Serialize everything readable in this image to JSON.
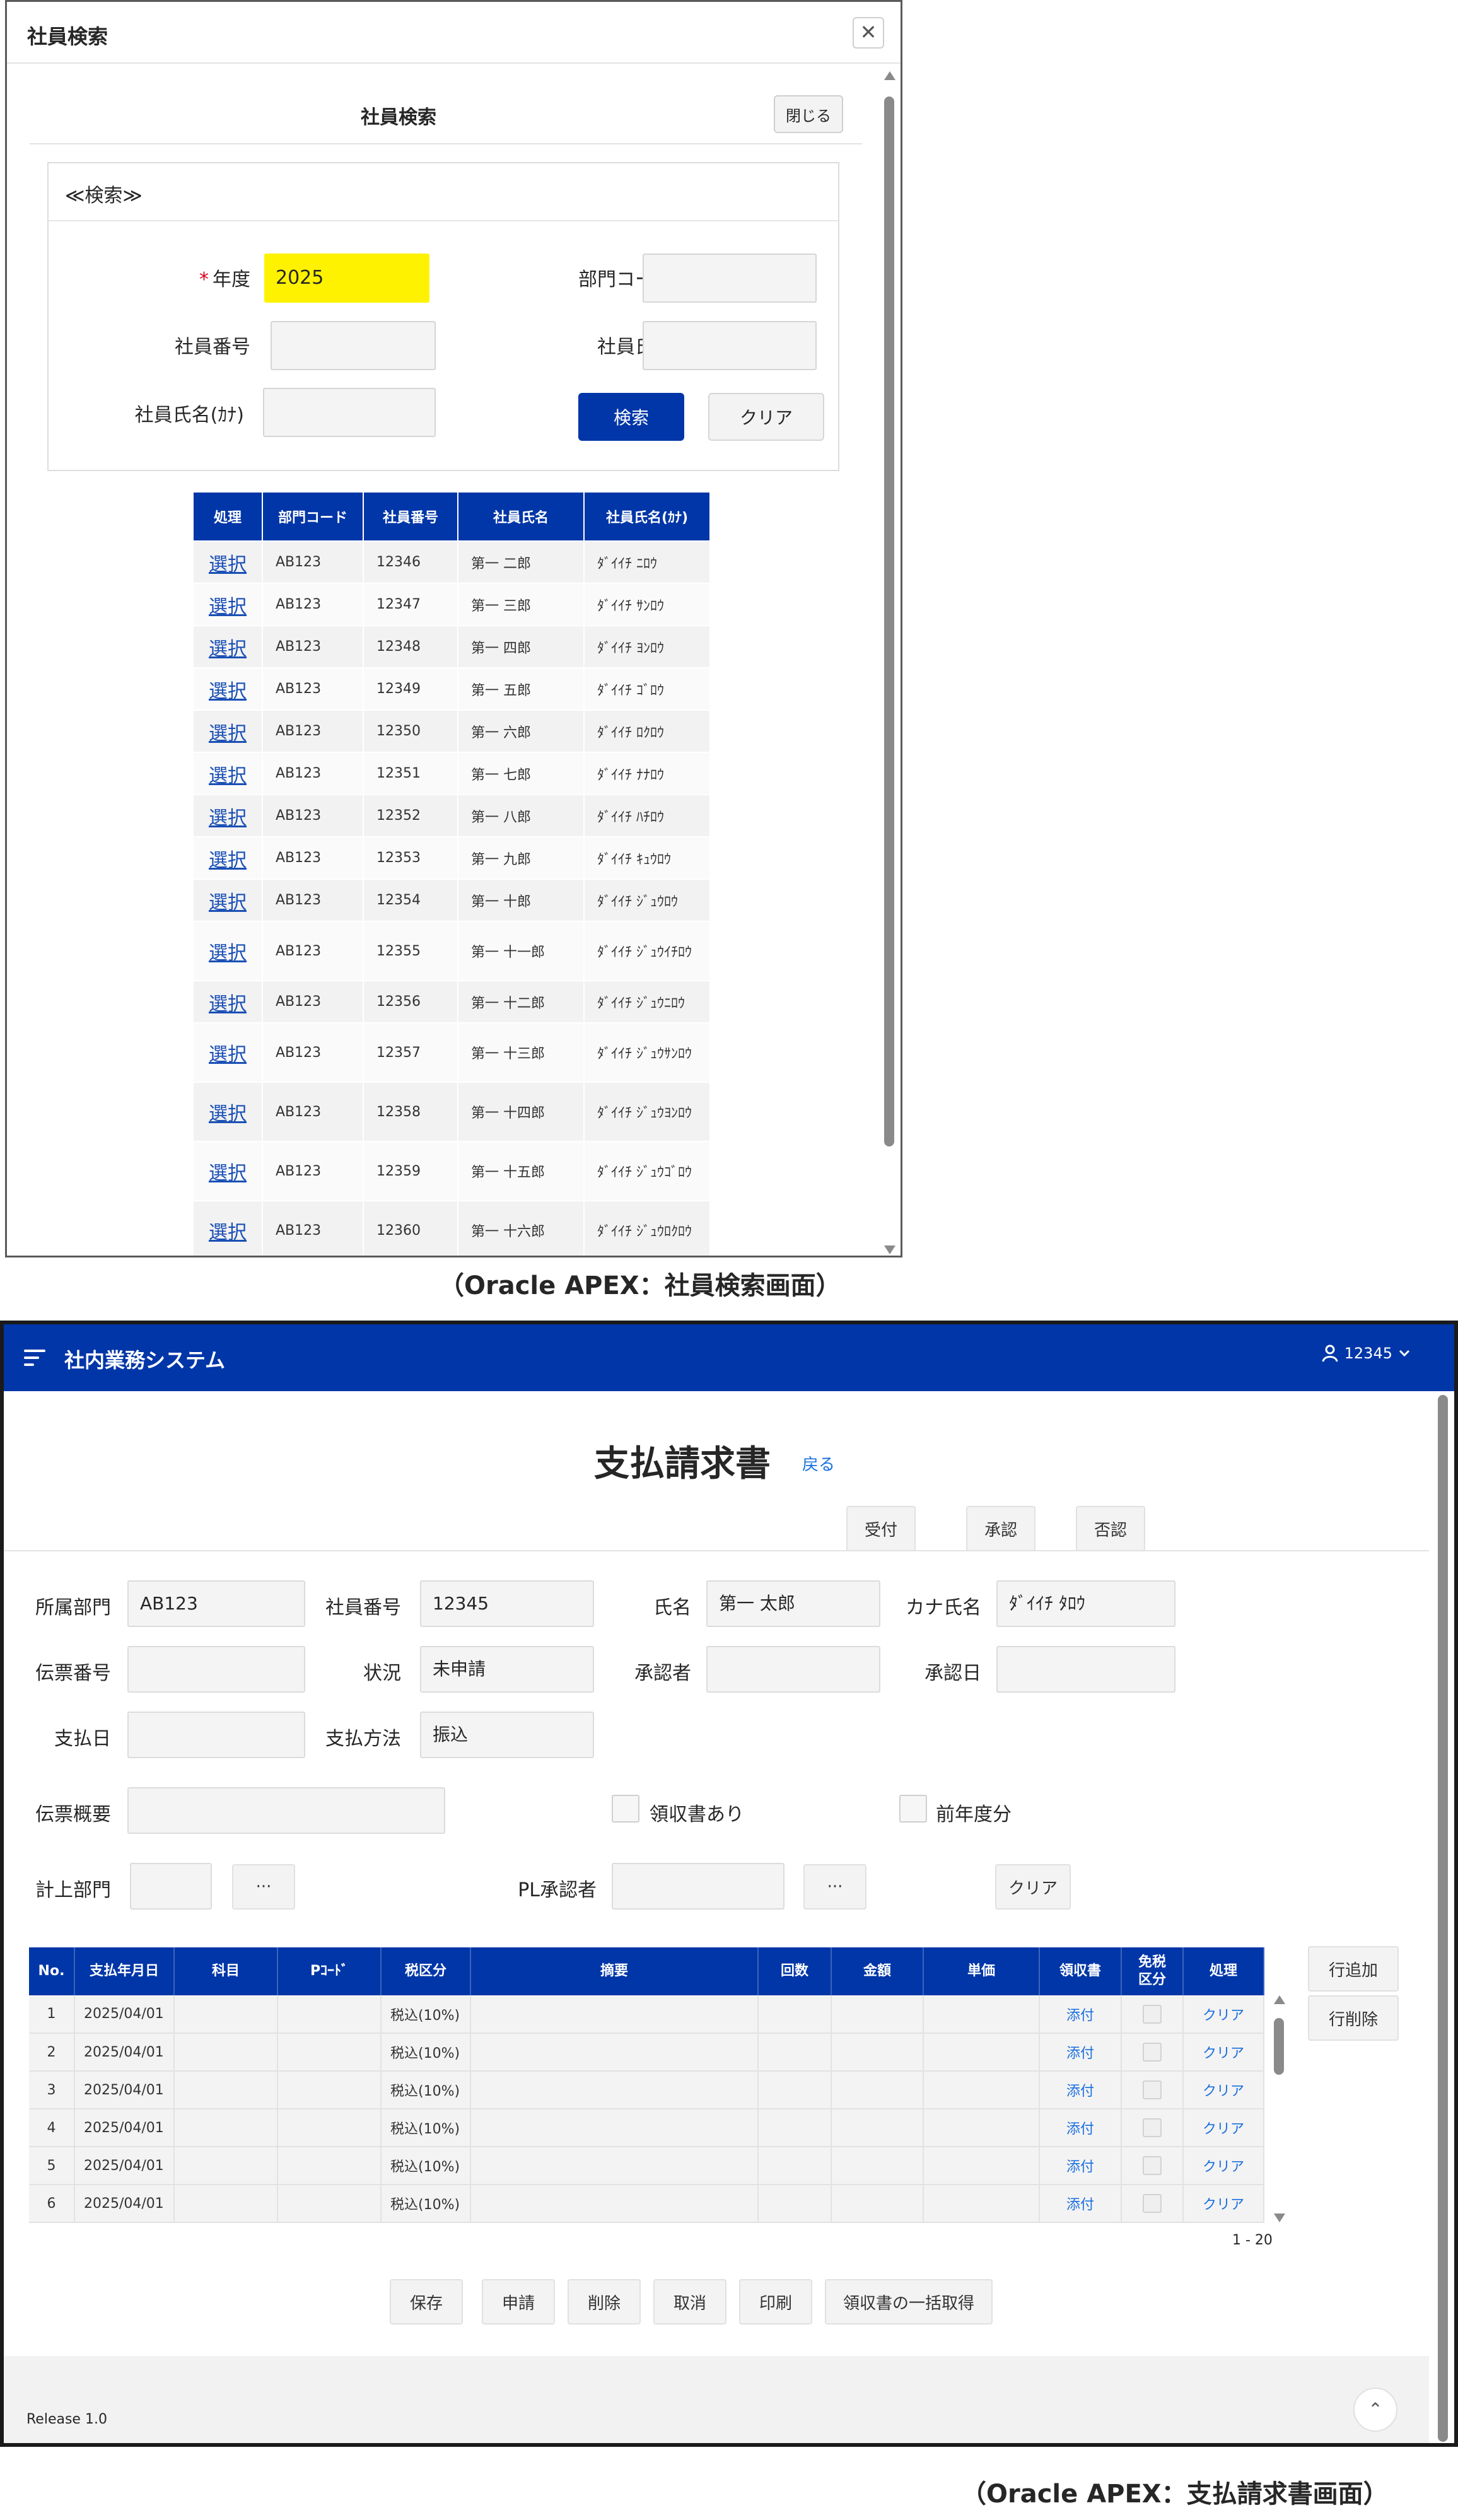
{
  "dialog": {
    "title": "社員検索",
    "close_x": "✕",
    "subtitle": "社員検索",
    "close_button": "閉じる",
    "search_region_title": "≪検索≫",
    "fields": {
      "year_label": "年度",
      "year_required": "*",
      "year_value": "2025",
      "dept_code_label": "部門コード",
      "emp_no_label": "社員番号",
      "emp_name_label": "社員氏名",
      "emp_kana_label": "社員氏名(ｶﾅ)"
    },
    "search_button": "検索",
    "clear_button": "クリア",
    "table": {
      "headers": [
        "処理",
        "部門コード",
        "社員番号",
        "社員氏名",
        "社員氏名(ｶﾅ)"
      ],
      "select_label": "選択",
      "rows": [
        [
          "AB123",
          "12346",
          "第一 二郎",
          "ﾀﾞｲｲﾁ ﾆﾛｳ"
        ],
        [
          "AB123",
          "12347",
          "第一 三郎",
          "ﾀﾞｲｲﾁ ｻﾝﾛｳ"
        ],
        [
          "AB123",
          "12348",
          "第一 四郎",
          "ﾀﾞｲｲﾁ ﾖﾝﾛｳ"
        ],
        [
          "AB123",
          "12349",
          "第一 五郎",
          "ﾀﾞｲｲﾁ ｺﾞﾛｳ"
        ],
        [
          "AB123",
          "12350",
          "第一 六郎",
          "ﾀﾞｲｲﾁ ﾛｸﾛｳ"
        ],
        [
          "AB123",
          "12351",
          "第一 七郎",
          "ﾀﾞｲｲﾁ ﾅﾅﾛｳ"
        ],
        [
          "AB123",
          "12352",
          "第一 八郎",
          "ﾀﾞｲｲﾁ ﾊﾁﾛｳ"
        ],
        [
          "AB123",
          "12353",
          "第一 九郎",
          "ﾀﾞｲｲﾁ ｷｭｳﾛｳ"
        ],
        [
          "AB123",
          "12354",
          "第一 十郎",
          "ﾀﾞｲｲﾁ ｼﾞｭｳﾛｳ"
        ],
        [
          "AB123",
          "12355",
          "第一 十一郎",
          "ﾀﾞｲｲﾁ ｼﾞｭｳｲﾁﾛｳ"
        ],
        [
          "AB123",
          "12356",
          "第一 十二郎",
          "ﾀﾞｲｲﾁ ｼﾞｭｳﾆﾛｳ"
        ],
        [
          "AB123",
          "12357",
          "第一 十三郎",
          "ﾀﾞｲｲﾁ ｼﾞｭｳｻﾝﾛｳ"
        ],
        [
          "AB123",
          "12358",
          "第一 十四郎",
          "ﾀﾞｲｲﾁ ｼﾞｭｳﾖﾝﾛｳ"
        ],
        [
          "AB123",
          "12359",
          "第一 十五郎",
          "ﾀﾞｲｲﾁ ｼﾞｭｳｺﾞﾛｳ"
        ],
        [
          "AB123",
          "12360",
          "第一 十六郎",
          "ﾀﾞｲｲﾁ ｼﾞｭｳﾛｸﾛｳ"
        ]
      ]
    }
  },
  "captions": {
    "top": "（Oracle APEX：社員検索画面）",
    "bottom": "（Oracle APEX：支払請求書画面）"
  },
  "app": {
    "title": "社内業務システム",
    "user": "12345",
    "page_title": "支払請求書",
    "back_link": "戻る",
    "workflow_buttons": [
      "受付",
      "承認",
      "否認"
    ],
    "form": {
      "dept_label": "所属部門",
      "dept_value": "AB123",
      "emp_no_label": "社員番号",
      "emp_no_value": "12345",
      "name_label": "氏名",
      "name_value": "第一 太郎",
      "kana_label": "カナ氏名",
      "kana_value": "ﾀﾞｲｲﾁ ﾀﾛｳ",
      "slip_no_label": "伝票番号",
      "slip_no_value": "",
      "status_label": "状況",
      "status_value": "未申請",
      "approver_label": "承認者",
      "approver_value": "",
      "approved_date_label": "承認日",
      "approved_date_value": "",
      "pay_date_label": "支払日",
      "pay_date_value": "",
      "pay_method_label": "支払方法",
      "pay_method_value": "振込",
      "summary_label": "伝票概要",
      "summary_value": "",
      "receipt_label": "領収書あり",
      "prev_year_label": "前年度分",
      "booking_dept_label": "計上部門",
      "pl_approver_label": "PL承認者",
      "ellipsis": "···",
      "clear_button": "クリア"
    },
    "grid": {
      "headers": [
        "No.",
        "支払年月日",
        "科目",
        "Pｺｰﾄﾞ",
        "税区分",
        "摘要",
        "回数",
        "金額",
        "単価",
        "領収書",
        "免税\n区分",
        "処理"
      ],
      "attach_label": "添付",
      "clear_label": "クリア",
      "rows": [
        [
          "1",
          "2025/04/01",
          "",
          "",
          "税込(10%)",
          "",
          "",
          "",
          ""
        ],
        [
          "2",
          "2025/04/01",
          "",
          "",
          "税込(10%)",
          "",
          "",
          "",
          ""
        ],
        [
          "3",
          "2025/04/01",
          "",
          "",
          "税込(10%)",
          "",
          "",
          "",
          ""
        ],
        [
          "4",
          "2025/04/01",
          "",
          "",
          "税込(10%)",
          "",
          "",
          "",
          ""
        ],
        [
          "5",
          "2025/04/01",
          "",
          "",
          "税込(10%)",
          "",
          "",
          "",
          ""
        ],
        [
          "6",
          "2025/04/01",
          "",
          "",
          "税込(10%)",
          "",
          "",
          "",
          ""
        ]
      ],
      "pager": "1 - 20",
      "add_row": "行追加",
      "delete_row": "行削除"
    },
    "bottom_buttons": [
      "保存",
      "申請",
      "削除",
      "取消",
      "印刷",
      "領収書の一括取得"
    ],
    "release": "Release 1.0",
    "to_top": "⌃"
  }
}
